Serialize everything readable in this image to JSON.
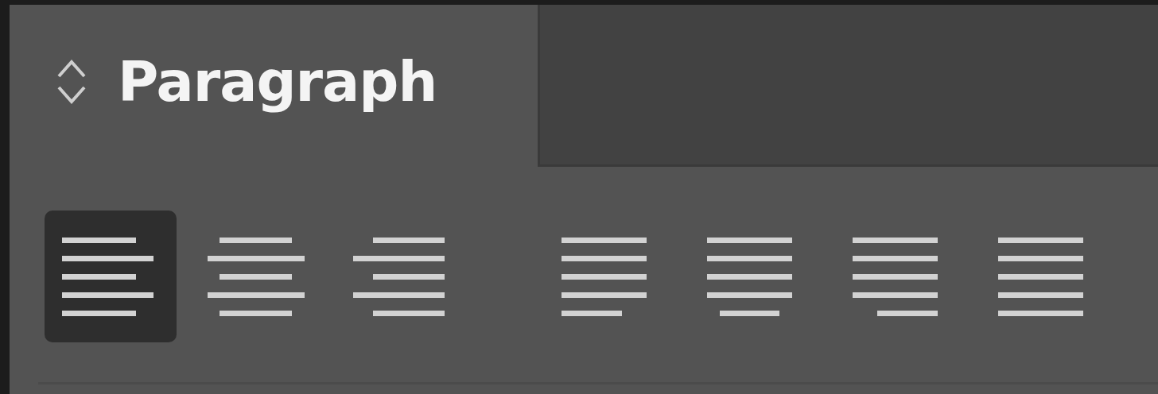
{
  "panel": {
    "title": "Paragraph"
  },
  "alignment_buttons": [
    {
      "kind": "left",
      "selected": true
    },
    {
      "kind": "center",
      "selected": false
    },
    {
      "kind": "right",
      "selected": false
    },
    {
      "kind": "justify-left",
      "selected": false
    },
    {
      "kind": "justify-center",
      "selected": false
    },
    {
      "kind": "justify-right",
      "selected": false
    },
    {
      "kind": "justify-all",
      "selected": false
    }
  ]
}
